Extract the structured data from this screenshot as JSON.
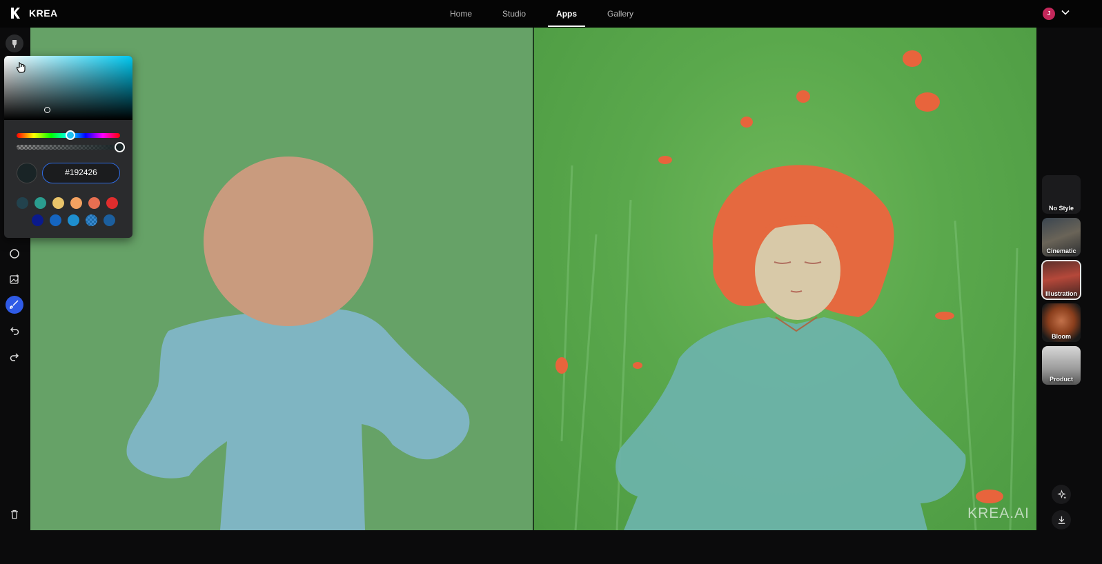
{
  "app": {
    "logo_text": "KREA"
  },
  "nav": {
    "items": [
      "Home",
      "Studio",
      "Apps",
      "Gallery"
    ],
    "active": "Apps"
  },
  "user": {
    "avatar_initial": "J",
    "avatar_color": "#c3285b"
  },
  "color_picker": {
    "hex_value": "#192426",
    "current_color": "#192426",
    "hue_color": "#1ec0f0",
    "presets": [
      "#22424d",
      "#2a9d8f",
      "#e9c46a",
      "#f4a261",
      "#e76f51",
      "#e02d2d",
      "#0a1a8c",
      "#1565c0",
      "#1e8fcf",
      "checker",
      "#1c5f9e"
    ]
  },
  "left_toolbar": {
    "tools": [
      "brush-settings-icon",
      "circle-shape-icon",
      "add-image-icon",
      "brush-icon",
      "undo-icon",
      "redo-icon",
      "trash-icon"
    ],
    "active_tool": "brush-icon"
  },
  "canvas": {
    "background_color": "#66a267",
    "head_color": "#c99b7e",
    "body_color": "#7fb5c2"
  },
  "output": {
    "watermark": "KREA.AI"
  },
  "styles": {
    "items": [
      "No Style",
      "Cinematic",
      "Illustration",
      "Bloom",
      "Product"
    ],
    "selected": "Illustration"
  },
  "side_actions": [
    "sparkle-icon",
    "download-icon"
  ]
}
